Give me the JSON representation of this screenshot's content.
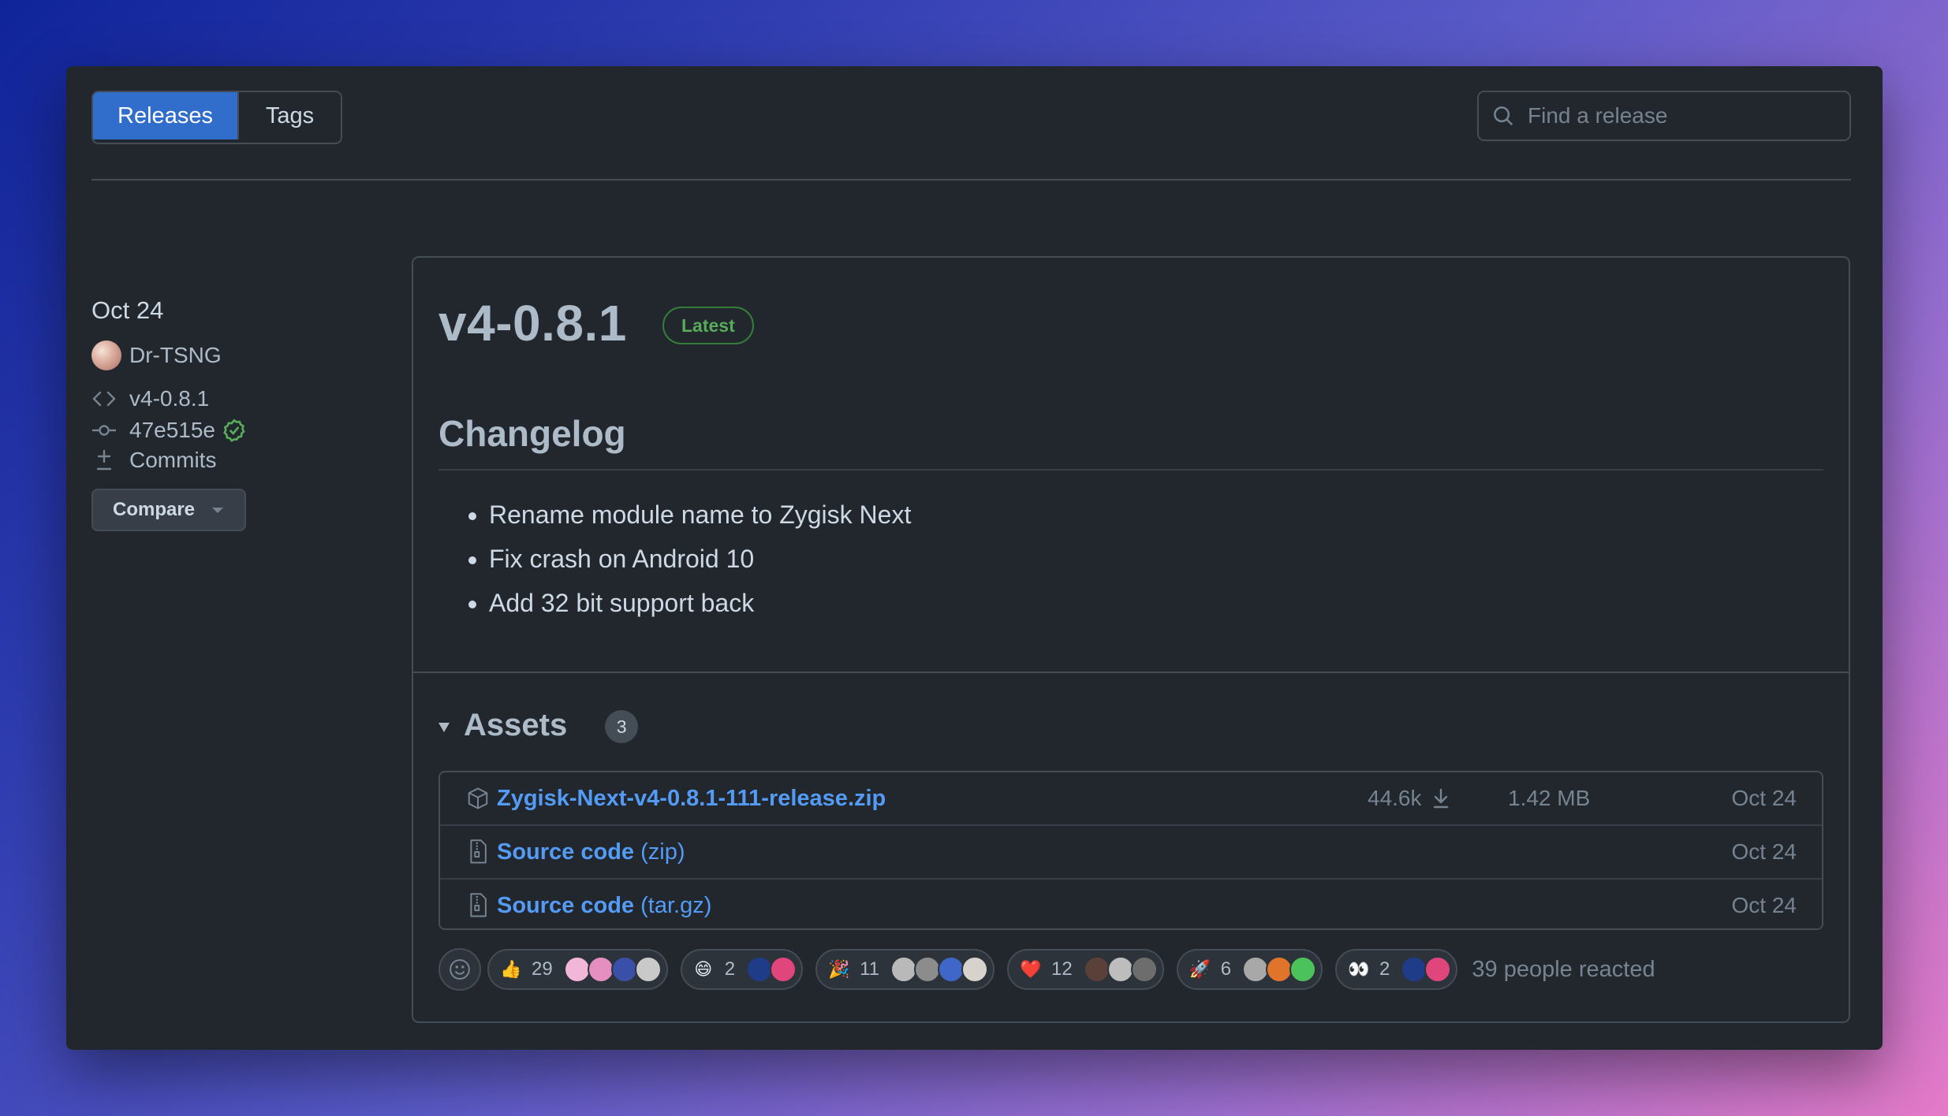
{
  "tabs": {
    "releases": "Releases",
    "tags": "Tags"
  },
  "search": {
    "placeholder": "Find a release"
  },
  "sidebar": {
    "date": "Oct 24",
    "author": "Dr-TSNG",
    "tag": "v4-0.8.1",
    "commit": "47e515e",
    "commits_label": "Commits",
    "compare_label": "Compare"
  },
  "release": {
    "title": "v4-0.8.1",
    "badge": "Latest",
    "changelog_heading": "Changelog",
    "changelog": [
      "Rename module name to Zygisk Next",
      "Fix crash on Android 10",
      "Add 32 bit support back"
    ]
  },
  "assets": {
    "heading": "Assets",
    "count": "3",
    "items": [
      {
        "name": "Zygisk-Next-v4-0.8.1-111-release.zip",
        "suffix": "",
        "downloads": "44.6k",
        "size": "1.42 MB",
        "date": "Oct 24",
        "icon": "package-icon"
      },
      {
        "name": "Source code",
        "suffix": "(zip)",
        "downloads": "",
        "size": "",
        "date": "Oct 24",
        "icon": "file-zip-icon"
      },
      {
        "name": "Source code",
        "suffix": "(tar.gz)",
        "downloads": "",
        "size": "",
        "date": "Oct 24",
        "icon": "file-zip-icon"
      }
    ]
  },
  "reactions": {
    "items": [
      {
        "emoji": "👍",
        "name": "thumbs-up",
        "count": "29"
      },
      {
        "emoji": "😄",
        "name": "smile",
        "count": "2"
      },
      {
        "emoji": "🎉",
        "name": "tada",
        "count": "11"
      },
      {
        "emoji": "❤️",
        "name": "heart",
        "count": "12"
      },
      {
        "emoji": "🚀",
        "name": "rocket",
        "count": "6"
      },
      {
        "emoji": "👀",
        "name": "eyes",
        "count": "2"
      }
    ],
    "summary": "39 people reacted"
  },
  "colors": {
    "accent": "#316dca",
    "link": "#539bf5",
    "success": "#57ab5a",
    "background": "#22272e"
  }
}
